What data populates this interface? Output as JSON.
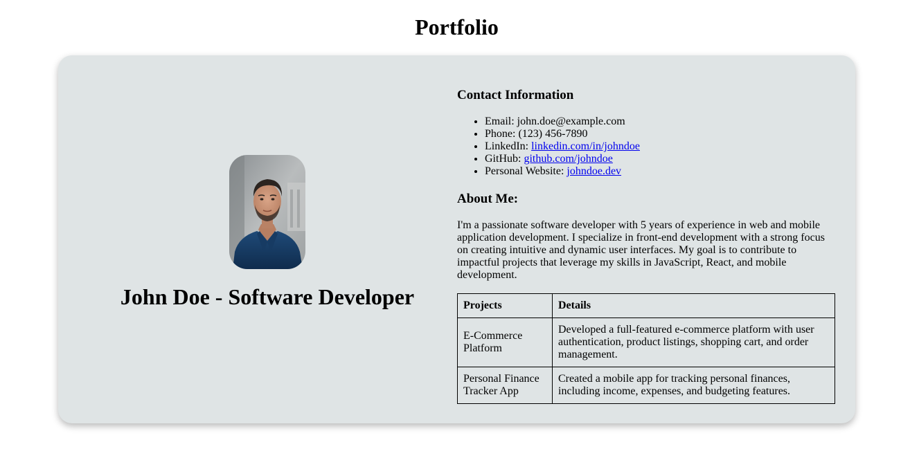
{
  "page": {
    "title": "Portfolio"
  },
  "profile": {
    "name_title": "John Doe - Software Developer",
    "photo_alt": "Portrait of John Doe"
  },
  "contact": {
    "heading": "Contact Information",
    "email_label": "Email: ",
    "email_value": "john.doe@example.com",
    "phone_label": "Phone: ",
    "phone_value": "(123) 456-7890",
    "linkedin_label": "LinkedIn: ",
    "linkedin_link": "linkedin.com/in/johndoe",
    "github_label": "GitHub: ",
    "github_link": "github.com/johndoe",
    "website_label": "Personal Website: ",
    "website_link": "johndoe.dev"
  },
  "about": {
    "heading": "About Me:",
    "text": "I'm a passionate software developer with 5 years of experience in web and mobile application development. I specialize in front-end development with a strong focus on creating intuitive and dynamic user interfaces. My goal is to contribute to impactful projects that leverage my skills in JavaScript, React, and mobile development."
  },
  "projects_table": {
    "headers": [
      "Projects",
      "Details"
    ],
    "rows": [
      {
        "project": "E-Commerce Platform",
        "details": "Developed a full-featured e-commerce platform with user authentication, product listings, shopping cart, and order management."
      },
      {
        "project": "Personal Finance Tracker App",
        "details": "Created a mobile app for tracking personal finances, including income, expenses, and budgeting features."
      }
    ]
  },
  "colors": {
    "card_background": "#dfe4e5",
    "link": "#0000ee"
  }
}
